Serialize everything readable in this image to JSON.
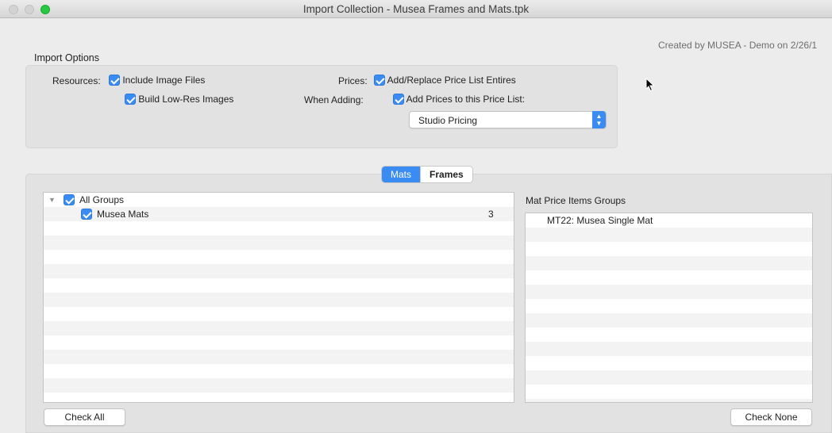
{
  "window": {
    "title": "Import Collection - Musea Frames and Mats.tpk"
  },
  "header": {
    "created_by": "Created by MUSEA - Demo on 2/26/1"
  },
  "import_options": {
    "section_label": "Import Options",
    "resources_label": "Resources:",
    "include_image_files": "Include Image Files",
    "build_low_res": "Build Low-Res Images",
    "prices_label": "Prices:",
    "add_replace": "Add/Replace Price List Entires",
    "when_adding_label": "When Adding:",
    "add_prices_to": "Add Prices to this Price List:",
    "price_list_selected": "Studio Pricing"
  },
  "tabs": [
    {
      "label": "Mats",
      "active": true
    },
    {
      "label": "Frames",
      "active": false
    }
  ],
  "groups_table": {
    "rows": [
      {
        "label": "All Groups",
        "count": "",
        "checked": true,
        "expanded": true
      },
      {
        "label": "Musea Mats",
        "count": "3",
        "checked": true
      }
    ]
  },
  "price_items": {
    "header": "Mat Price Items Groups",
    "rows": [
      "MT22: Musea Single Mat"
    ]
  },
  "buttons": {
    "check_all": "Check All",
    "check_none": "Check None"
  },
  "colors": {
    "accent": "#3b8cf2",
    "zoom_green": "#28c840"
  }
}
